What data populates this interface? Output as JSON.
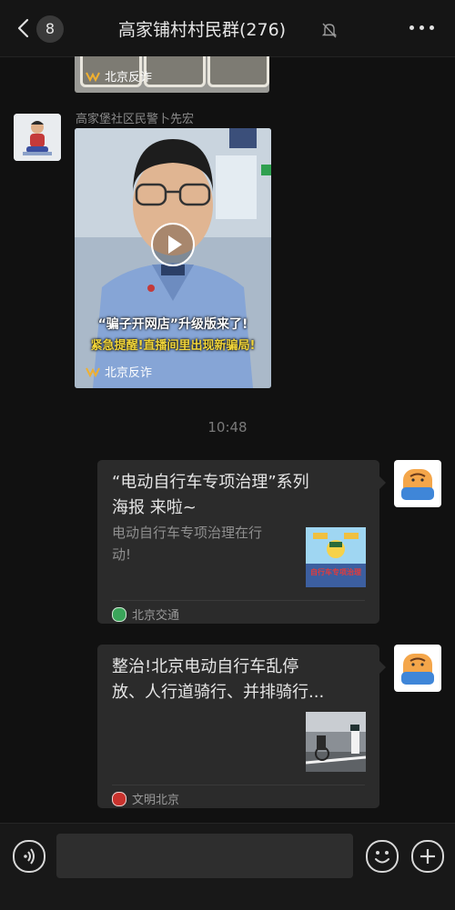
{
  "header": {
    "back_badge": "8",
    "title": "高家铺村村民群(276)"
  },
  "messages": {
    "video_card_top": {
      "watermark": "北京反诈"
    },
    "video": {
      "sender": "高家堡社区民警卜先宏",
      "caption_line1": "“骗子开网店”升级版来了!",
      "caption_line2": "紧急提醒!直播间里出现新骗局!",
      "watermark": "北京反诈"
    },
    "timestamp": "10:48",
    "link1": {
      "title_line1": "“电动自行车专项治理”系列",
      "title_line2": "海报 来啦~",
      "desc_line1": "电动自行车专项治理在行",
      "desc_line2": "动!",
      "source": "北京交通",
      "thumb_text": "自行车专项治理"
    },
    "link2": {
      "title_line1": "整治!北京电动自行车乱停",
      "title_line2": "放、人行道骑行、并排骑行...",
      "source": "文明北京"
    }
  },
  "colors": {
    "background": "#111111",
    "bubble": "#2b2b2b",
    "source_green": "#3aa55a",
    "source_red": "#c8322d"
  }
}
